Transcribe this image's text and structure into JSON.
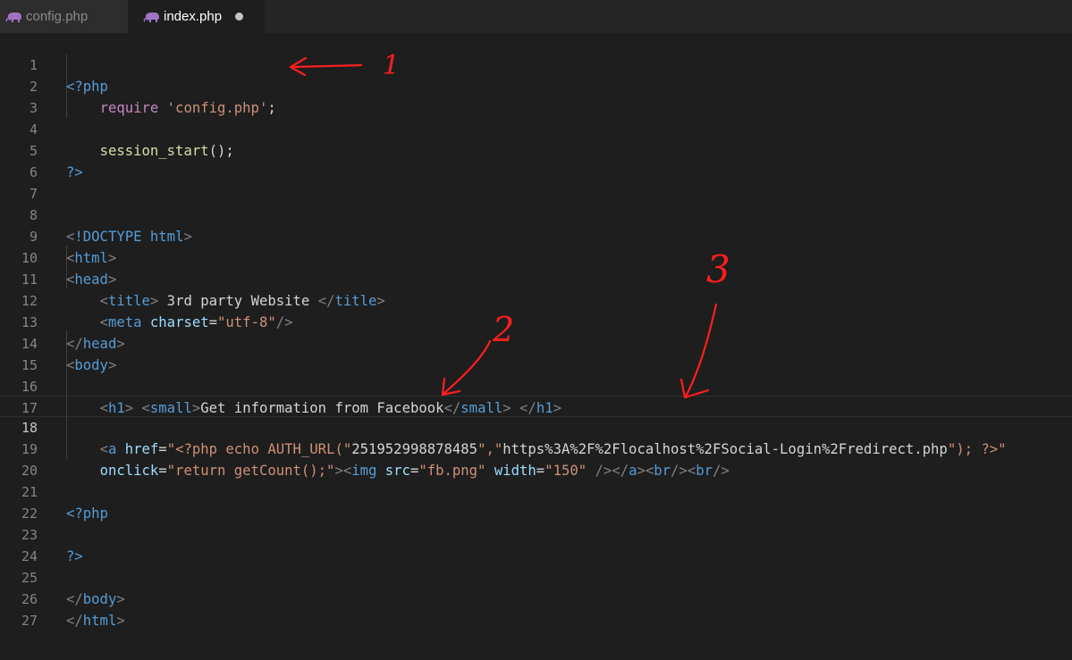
{
  "tabs": [
    {
      "label": "config.php",
      "active": false,
      "modified": false
    },
    {
      "label": "index.php",
      "active": true,
      "modified": true
    }
  ],
  "editor": {
    "language": "php",
    "current_line": 18,
    "lines": [
      {
        "n": "1",
        "text": "<?php"
      },
      {
        "n": "2",
        "text": "    require 'config.php';"
      },
      {
        "n": "3",
        "text": ""
      },
      {
        "n": "4",
        "text": "    session_start();"
      },
      {
        "n": "5",
        "text": "?>"
      },
      {
        "n": "6",
        "text": ""
      },
      {
        "n": "7",
        "text": ""
      },
      {
        "n": "8",
        "text": "<!DOCTYPE html>"
      },
      {
        "n": "9",
        "text": "<html>"
      },
      {
        "n": "10",
        "text": "<head>"
      },
      {
        "n": "11",
        "text": "    <title> 3rd party Website </title>"
      },
      {
        "n": "12",
        "text": "    <meta charset=\"utf-8\"/>"
      },
      {
        "n": "13",
        "text": "</head>"
      },
      {
        "n": "14",
        "text": "<body>"
      },
      {
        "n": "15",
        "text": ""
      },
      {
        "n": "16",
        "text": "    <h1> <small>Get information from Facebook</small> </h1>"
      },
      {
        "n": "17",
        "text": ""
      },
      {
        "n": "18",
        "text": "    <a href=\"<?php echo AUTH_URL(\"251952998878485\",\"https%3A%2F%2Flocalhost%2FSocial-Login%2Fredirect.php\"); ?>\""
      },
      {
        "n": "19",
        "text": "    onclick=\"return getCount();\"><img src=\"fb.png\" width=\"150\" /></a><br/><br/>"
      },
      {
        "n": "20",
        "text": ""
      },
      {
        "n": "21",
        "text": "<?php"
      },
      {
        "n": "22",
        "text": ""
      },
      {
        "n": "23",
        "text": "?>"
      },
      {
        "n": "24",
        "text": ""
      },
      {
        "n": "25",
        "text": "</body>"
      },
      {
        "n": "26",
        "text": "</html>"
      },
      {
        "n": "27",
        "text": ""
      }
    ]
  },
  "annotations": [
    {
      "label": "1",
      "color": "#ff1e1e"
    },
    {
      "label": "2",
      "color": "#ff1e1e"
    },
    {
      "label": "3",
      "color": "#ff1e1e"
    }
  ],
  "colors": {
    "background": "#1e1e1e",
    "tag": "#569cd6",
    "attribute": "#9cdcfe",
    "string": "#ce9178",
    "function": "#dcdcaa",
    "keyword": "#c586c0",
    "annotation": "#ff1e1e"
  }
}
